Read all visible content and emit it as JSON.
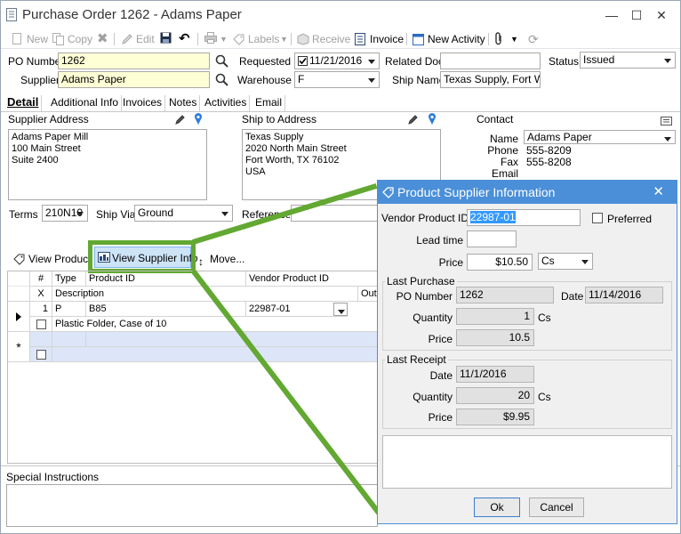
{
  "window": {
    "title": "Purchase Order 1262 - Adams Paper"
  },
  "toolbar": {
    "new": "New",
    "copy": "Copy",
    "edit": "Edit",
    "labels": "Labels",
    "receive": "Receive",
    "invoice": "Invoice",
    "new_activity": "New Activity"
  },
  "header": {
    "po_number_label": "PO Number",
    "po_number": "1262",
    "supplier_label": "Supplier",
    "supplier": "Adams Paper",
    "requested_label": "Requested",
    "requested": "11/21/2016",
    "warehouse_label": "Warehouse",
    "warehouse": "F",
    "related_doc_label": "Related Doc",
    "related_doc": "",
    "ship_name_label": "Ship Name",
    "ship_name": "Texas Supply, Fort Wc",
    "status_label": "Status",
    "status": "Issued"
  },
  "tabs": [
    "Detail",
    "Additional Info",
    "Invoices",
    "Notes",
    "Activities",
    "Email"
  ],
  "detail": {
    "supplier_address_label": "Supplier Address",
    "supplier_address": [
      "Adams Paper Mill",
      "100 Main Street",
      "Suite 2400"
    ],
    "ship_to_label": "Ship to Address",
    "ship_to": [
      "Texas Supply",
      "2020 North Main Street",
      "Fort Worth, TX 76102",
      "USA"
    ],
    "contact_label": "Contact",
    "contact_name_label": "Name",
    "contact_name": "Adams Paper",
    "phone_label": "Phone",
    "phone": "555-8209",
    "fax_label": "Fax",
    "fax": "555-8208",
    "email_label": "Email",
    "terms_label": "Terms",
    "terms": "210N10",
    "ship_via_label": "Ship Via",
    "ship_via": "Ground",
    "reference_label": "Reference"
  },
  "lines_toolbar": {
    "view_product": "View Product",
    "view_supplier_info": "View Supplier Info",
    "move": "Move..."
  },
  "grid": {
    "h_num": "#",
    "h_type": "Type",
    "h_product_id": "Product ID",
    "h_vendor_product_id": "Vendor Product ID",
    "h_x": "X",
    "h_description": "Description",
    "h_outs": "Outs",
    "row1": {
      "num": "1",
      "type": "P",
      "product_id": "B85",
      "vendor_product_id": "22987-01",
      "description": "Plastic Folder, Case of 10"
    },
    "new_row_marker": "*"
  },
  "special_instructions_label": "Special Instructions",
  "dialog": {
    "title": "Product Supplier Information",
    "vendor_product_id_label": "Vendor Product ID",
    "vendor_product_id": "22987-01",
    "preferred_label": "Preferred",
    "lead_time_label": "Lead time",
    "lead_time": "",
    "price_label": "Price",
    "price": "$10.50",
    "unit": "Cs",
    "last_purchase": {
      "label": "Last Purchase",
      "po_number_label": "PO Number",
      "po_number": "1262",
      "date_label": "Date",
      "date": "11/14/2016",
      "quantity_label": "Quantity",
      "quantity": "1",
      "unit": "Cs",
      "price_label": "Price",
      "price": "10.5"
    },
    "last_receipt": {
      "label": "Last Receipt",
      "date_label": "Date",
      "date": "11/1/2016",
      "quantity_label": "Quantity",
      "quantity": "20",
      "unit": "Cs",
      "price_label": "Price",
      "price": "$9.95"
    },
    "ok": "Ok",
    "cancel": "Cancel"
  },
  "colors": {
    "accent": "#4a8fd8",
    "highlight": "#62a832",
    "required": "#ffffd6"
  }
}
